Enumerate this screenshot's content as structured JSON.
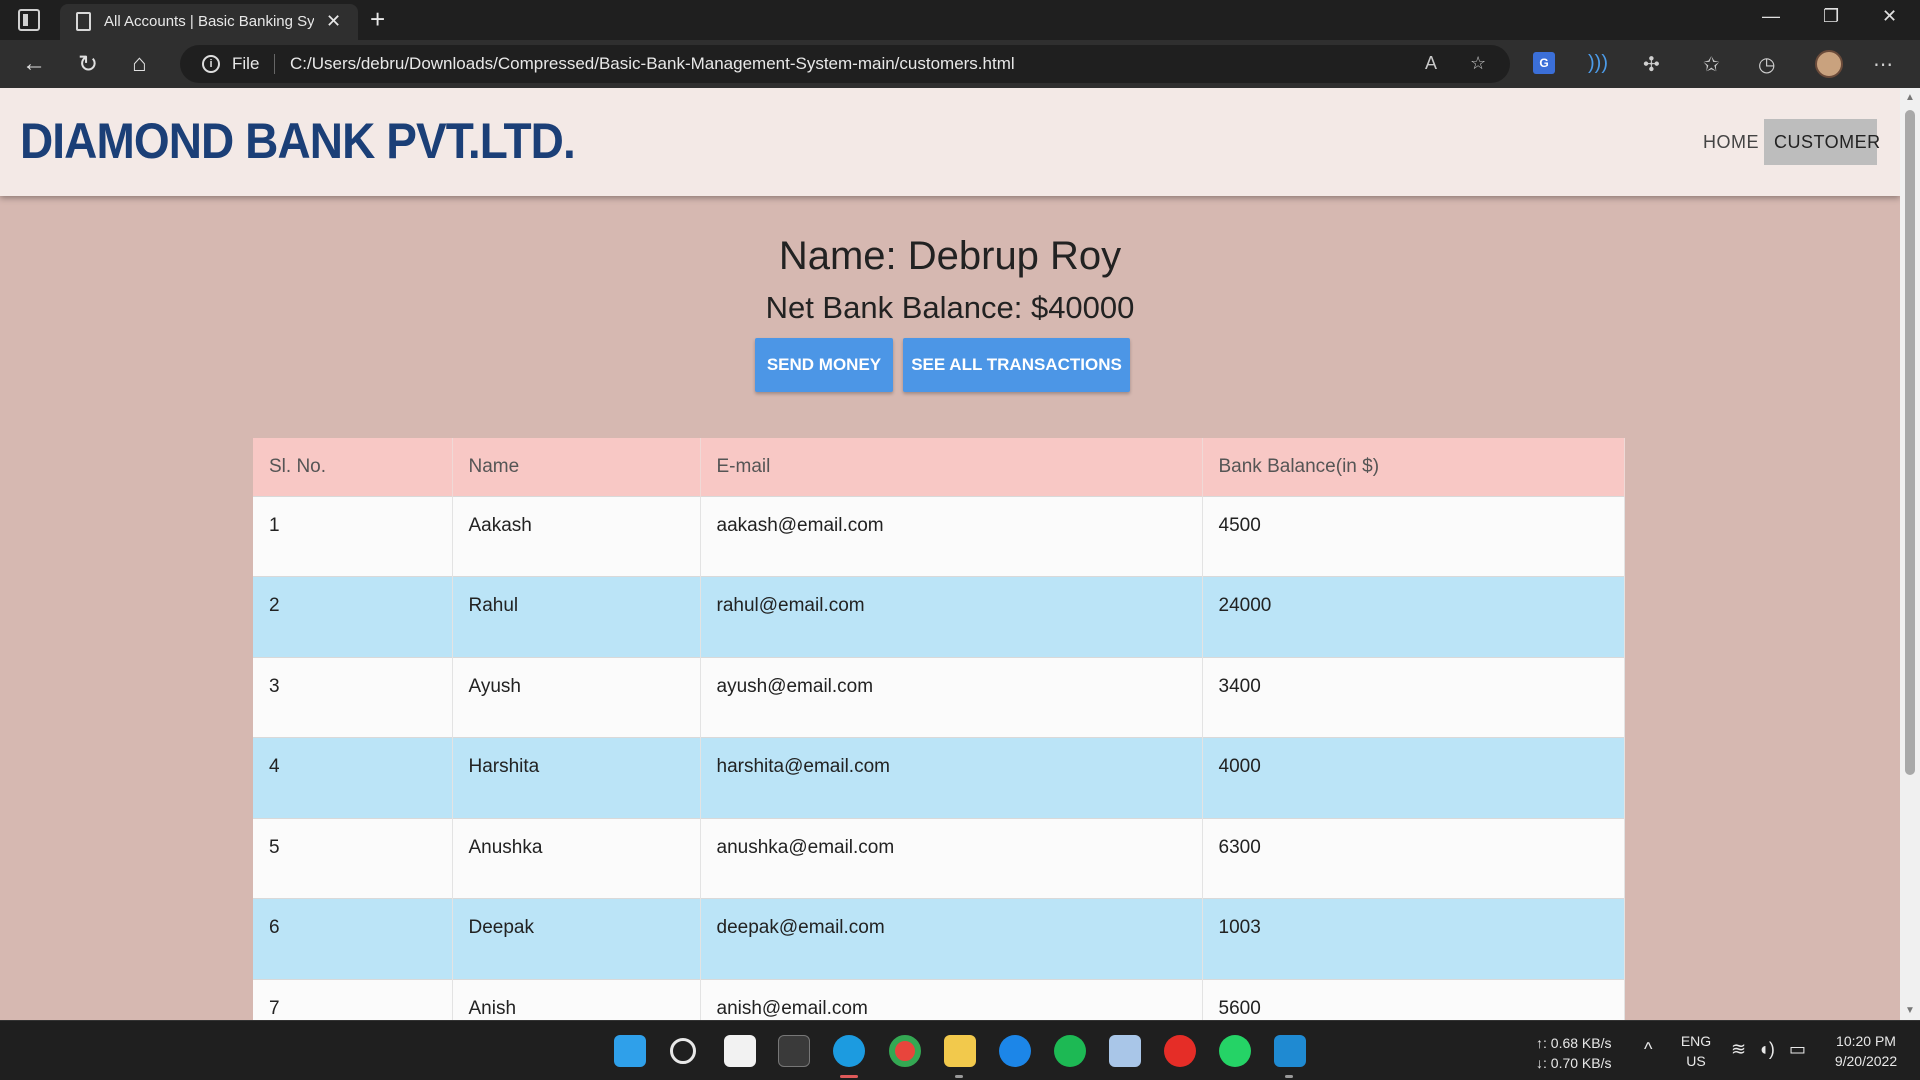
{
  "browser": {
    "tab_title": "All Accounts | Basic Banking System",
    "tab_close": "✕",
    "new_tab": "+",
    "file_label": "File",
    "url": "C:/Users/debru/Downloads/Compressed/Basic-Bank-Management-System-main/customers.html",
    "minimize": "—",
    "restore": "❐",
    "close": "✕"
  },
  "site": {
    "logo": "DIAMOND BANK PVT.LTD.",
    "nav": {
      "home": "HOME",
      "customer": "CUSTOMER"
    }
  },
  "profile": {
    "name_line": "Name: Debrup Roy",
    "balance_line": "Net Bank Balance: $40000",
    "send_money_label": "SEND MONEY",
    "see_all_label": "SEE ALL TRANSACTIONS"
  },
  "table": {
    "headers": [
      "Sl. No.",
      "Name",
      "E-mail",
      "Bank Balance(in $)"
    ],
    "rows": [
      [
        "1",
        "Aakash",
        "aakash@email.com",
        "4500"
      ],
      [
        "2",
        "Rahul",
        "rahul@email.com",
        "24000"
      ],
      [
        "3",
        "Ayush",
        "ayush@email.com",
        "3400"
      ],
      [
        "4",
        "Harshita",
        "harshita@email.com",
        "4000"
      ],
      [
        "5",
        "Anushka",
        "anushka@email.com",
        "6300"
      ],
      [
        "6",
        "Deepak",
        "deepak@email.com",
        "1003"
      ],
      [
        "7",
        "Anish",
        "anish@email.com",
        "5600"
      ]
    ]
  },
  "taskbar": {
    "net_up": "↑: 0.68 KB/s",
    "net_down": "↓: 0.70 KB/s",
    "lang_top": "ENG",
    "lang_bottom": "US",
    "time": "10:20 PM",
    "date": "9/20/2022"
  }
}
